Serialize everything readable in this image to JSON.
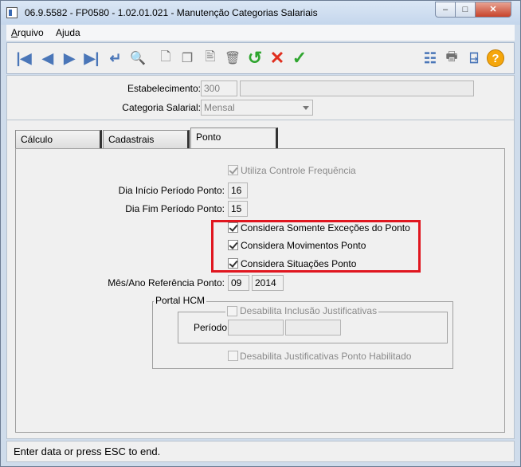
{
  "window": {
    "title": "06.9.5582 - FP0580 - 1.02.01.021 - Manutenção Categorias Salariais",
    "controls": {
      "minimize": "–",
      "maximize": "□",
      "close": "✕"
    }
  },
  "menu": {
    "items": [
      {
        "label": "Arquivo",
        "accel": "A",
        "rest": "rquivo"
      },
      {
        "label": "Ajuda",
        "accel": "j",
        "pre": "A",
        "rest": "uda"
      }
    ]
  },
  "toolbar": {
    "icons": [
      "first-icon",
      "prev-icon",
      "next-icon",
      "last-icon",
      "goto-icon",
      "search-icon",
      "new-icon",
      "copy-icon",
      "edit-icon",
      "delete-icon",
      "undo-icon",
      "cancel-icon",
      "save-icon",
      "tree-icon",
      "print-icon",
      "exit-icon",
      "help-icon"
    ]
  },
  "header": {
    "estabelecimento_label": "Estabelecimento:",
    "estabelecimento_value": "300",
    "estabelecimento_desc": "",
    "categoria_label": "Categoria Salarial:",
    "categoria_value": "Mensal"
  },
  "tabs": [
    {
      "label": "Cálculo"
    },
    {
      "label": "Cadastrais"
    },
    {
      "label": "Ponto",
      "active": true
    }
  ],
  "ponto": {
    "utiliza_label": "Utiliza Controle Frequência",
    "utiliza_checked": true,
    "dia_inicio_label": "Dia Início Período Ponto:",
    "dia_inicio_value": "16",
    "dia_fim_label": "Dia Fim Período Ponto:",
    "dia_fim_value": "15",
    "excecoes_label": "Considera Somente Exceções do Ponto",
    "excecoes_checked": true,
    "movimentos_label": "Considera Movimentos Ponto",
    "movimentos_checked": true,
    "situacoes_label": "Considera Situações Ponto",
    "situacoes_checked": true,
    "mes_ano_label": "Mês/Ano Referência Ponto:",
    "mes_value": "09",
    "ano_value": "2014",
    "portal_legend": "Portal HCM",
    "desabilita_inclusao_label": "Desabilita Inclusão Justificativas",
    "periodo_label": "Período:",
    "periodo_de": "",
    "periodo_ate": "",
    "desabilita_just_label": "Desabilita Justificativas Ponto Habilitado"
  },
  "status": {
    "text": "Enter data or press ESC to end."
  },
  "colors": {
    "highlight": "#e0161f",
    "accent": "#4a76b8"
  }
}
